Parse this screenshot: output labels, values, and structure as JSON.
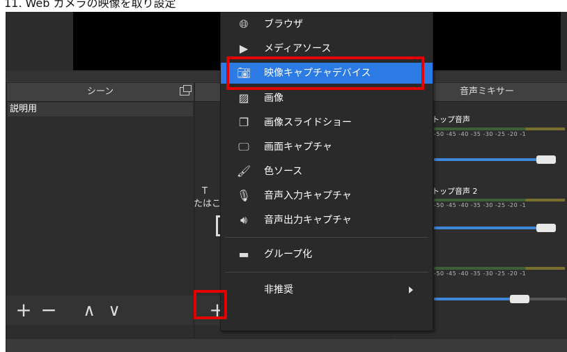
{
  "caption": "11. Web カメラの映像を取り設定",
  "scenes": {
    "title": "シーン",
    "items": [
      "説明用"
    ],
    "toolbar": {
      "add": "+",
      "remove": "−",
      "up": "∧",
      "down": "∨"
    }
  },
  "sources": {
    "hint_line1": "T",
    "hint_line2": "たはこ",
    "add": "+"
  },
  "mixer": {
    "title": "音声ミキサー",
    "tracks": [
      {
        "name": "トップ音声"
      },
      {
        "name": "トップ音声 2"
      },
      {
        "name": ""
      }
    ],
    "tick_labels": "-50  -45  -40  -35  -30  -25  -20  -1"
  },
  "context_menu": {
    "items": [
      {
        "icon": "globe-icon",
        "label": "ブラウザ"
      },
      {
        "icon": "play-icon",
        "label": "メディアソース"
      },
      {
        "icon": "camera-icon",
        "label": "映像キャプチャデバイス",
        "highlighted": true
      },
      {
        "icon": "image-icon",
        "label": "画像"
      },
      {
        "icon": "slideshow-icon",
        "label": "画像スライドショー"
      },
      {
        "icon": "monitor-icon",
        "label": "画面キャプチャ"
      },
      {
        "icon": "brush-icon",
        "label": "色ソース"
      },
      {
        "icon": "microphone-icon",
        "label": "音声入力キャプチャ"
      },
      {
        "icon": "speaker-icon",
        "label": "音声出力キャプチャ"
      },
      {
        "icon": "folder-icon",
        "label": "グループ化"
      },
      {
        "icon": "",
        "label": "非推奨",
        "submenu": true
      }
    ]
  },
  "colors": {
    "highlight": "#2c7be5",
    "frame": "#e50000"
  }
}
